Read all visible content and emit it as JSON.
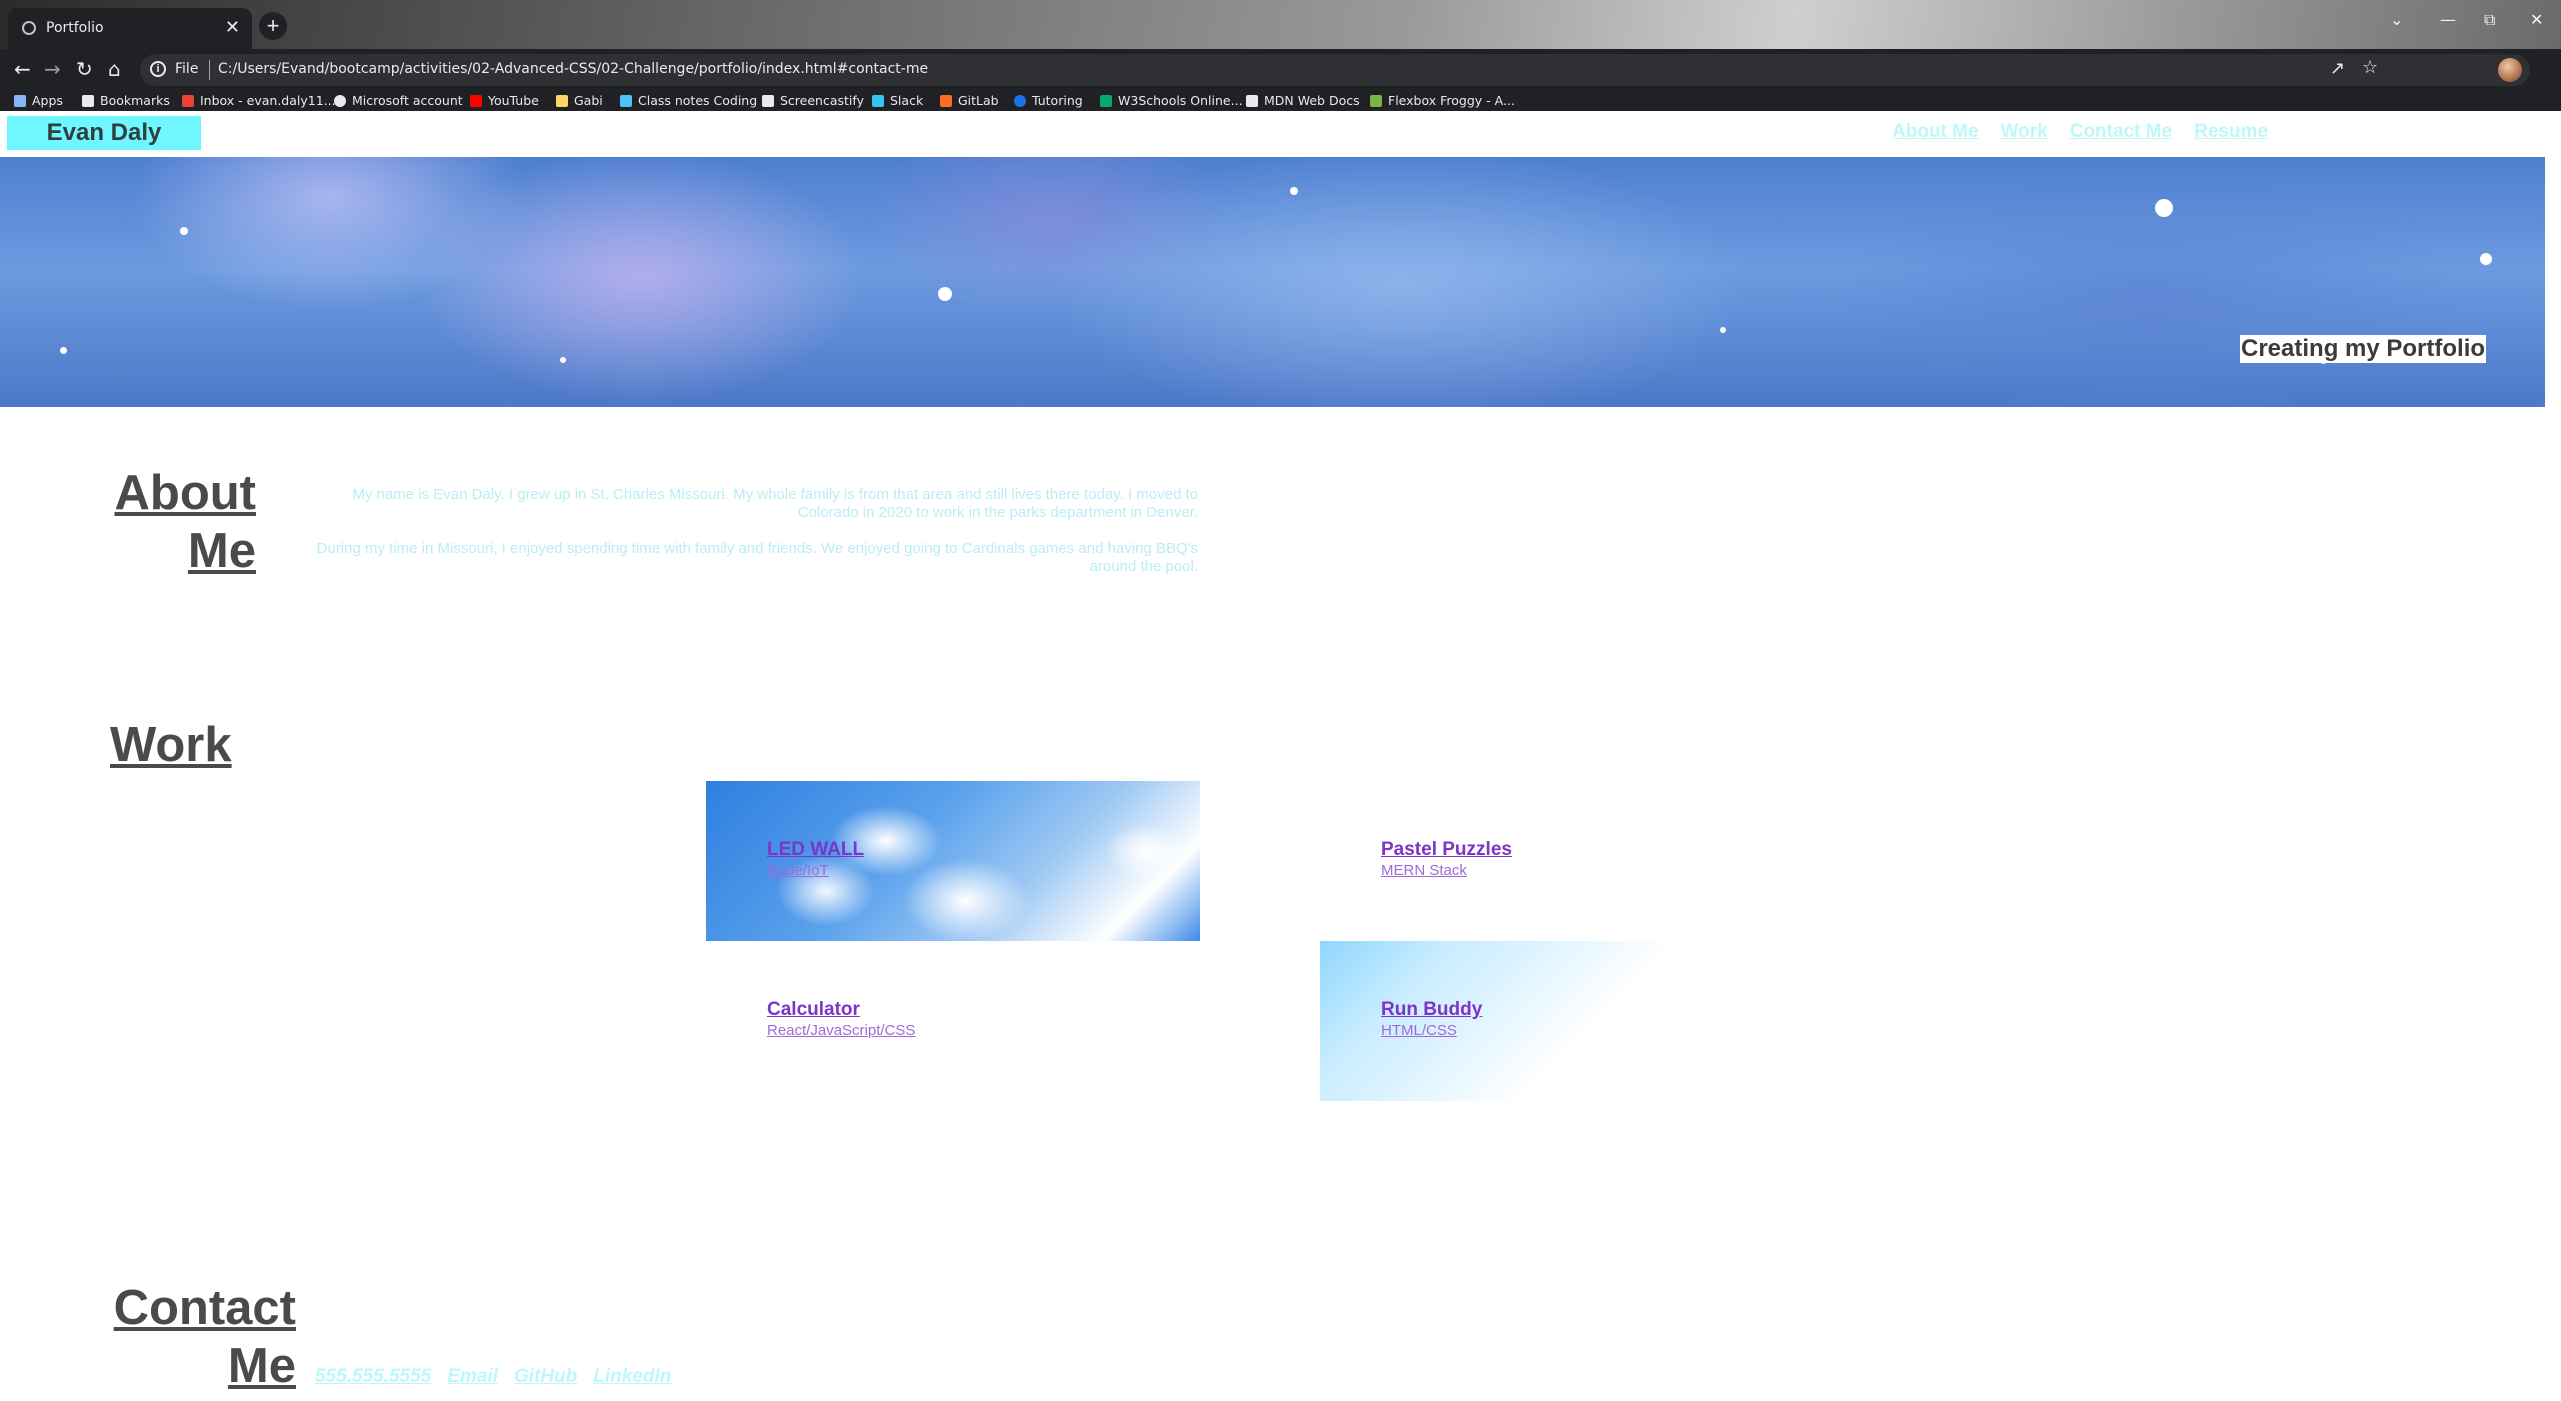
{
  "browser": {
    "tab_title": "Portfolio",
    "tab_close": "✕",
    "new_tab": "+",
    "omnibox_scheme": "File",
    "url": "C:/Users/Evand/bootcamp/activities/02-Advanced-CSS/02-Challenge/portfolio/index.html#contact-me",
    "window_controls": [
      "⌄",
      "—",
      "⧉",
      "✕"
    ],
    "nav_icons": [
      "back-icon",
      "forward-icon",
      "reload-icon",
      "home-icon"
    ],
    "bookmarks": [
      {
        "label": "Apps",
        "color": "#8ab4f8"
      },
      {
        "label": "Bookmarks",
        "color": "#e8eaed"
      },
      {
        "label": "Inbox - evan.daly11...",
        "color": "#ea4335"
      },
      {
        "label": "Microsoft account",
        "color": "#e8eaed"
      },
      {
        "label": "YouTube",
        "color": "#ff0000"
      },
      {
        "label": "Gabi",
        "color": "#fdd663"
      },
      {
        "label": "Class notes Coding",
        "color": "#4fc3f7"
      },
      {
        "label": "Screencastify",
        "color": "#e8eaed"
      },
      {
        "label": "Slack",
        "color": "#36c5f0"
      },
      {
        "label": "GitLab",
        "color": "#fc6d26"
      },
      {
        "label": "Tutoring",
        "color": "#1a73e8"
      },
      {
        "label": "W3Schools Online...",
        "color": "#04aa6d"
      },
      {
        "label": "MDN Web Docs",
        "color": "#e8eaed"
      },
      {
        "label": "Flexbox Froggy - A...",
        "color": "#7cb342"
      }
    ]
  },
  "header": {
    "brand": "Evan Daly",
    "nav": [
      "About Me",
      "Work",
      "Contact Me",
      "Resume"
    ],
    "brand_color": "#6ff6ff"
  },
  "hero": {
    "caption": "Creating my Portfolio"
  },
  "about": {
    "title_line1": "About",
    "title_line2": "Me",
    "paragraph1": "My name is Evan Daly. I grew up in St. Charles Missouri. My whole family is from that area and still lives there today. I moved to Colorado in 2020 to work in the parks department in Denver.",
    "paragraph2": "During my time in Missouri, I enjoyed spending time with family and friends. We enjoyed going to Cardinals games and having BBQ's around the pool."
  },
  "work": {
    "title": "Work",
    "projects": [
      {
        "name": "LED WALL",
        "tech": "Node/IoT"
      },
      {
        "name": "Pastel Puzzles",
        "tech": "MERN Stack"
      },
      {
        "name": "Calculator",
        "tech": "React/JavaScript/CSS"
      },
      {
        "name": "Run Buddy",
        "tech": "HTML/CSS"
      }
    ]
  },
  "contact": {
    "title_line1": "Contact",
    "title_line2": "Me",
    "links": [
      "555.555.5555",
      "Email",
      "GitHub",
      "LinkedIn"
    ]
  }
}
